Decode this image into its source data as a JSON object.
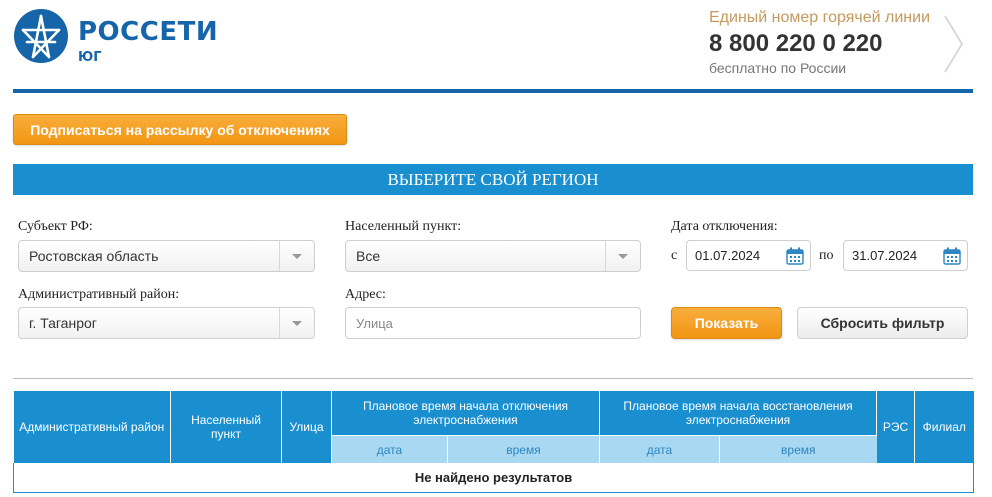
{
  "header": {
    "logo_title": "РОССЕТИ",
    "logo_subtitle": "ЮГ",
    "hotline_label": "Единый номер горячей линии",
    "hotline_number": "8 800 220 0 220",
    "hotline_note": "бесплатно по России"
  },
  "subscribe_label": "Подписаться на рассылку об отключениях",
  "region_title": "ВЫБЕРИТЕ СВОЙ РЕГИОН",
  "filters": {
    "subject_label": "Субъект РФ:",
    "subject_value": "Ростовская область",
    "locality_label": "Населенный пункт:",
    "locality_value": "Все",
    "date_label": "Дата отключения:",
    "date_from_prefix": "с",
    "date_from": "01.07.2024",
    "date_to_prefix": "по",
    "date_to": "31.07.2024",
    "district_label": "Административный район:",
    "district_value": "г. Таганрог",
    "address_label": "Адрес:",
    "address_placeholder": "Улица",
    "show_label": "Показать",
    "reset_label": "Сбросить фильтр"
  },
  "table": {
    "columns": [
      "Административный район",
      "Населенный пункт",
      "Улица",
      "Плановое время начала отключения электроснабжения",
      "Плановое время начала восстановления электроснабжения",
      "РЭС",
      "Филиал"
    ],
    "subcolumns": [
      "дата",
      "время",
      "дата",
      "время"
    ],
    "empty_message": "Не найдено результатов"
  },
  "colors": {
    "brand_blue": "#1565a8",
    "header_blue": "#1a8fd0",
    "subheader_blue": "#a8d8f2",
    "accent_orange": "#f29513",
    "hotline_gold": "#c49a5c"
  },
  "icons": [
    "rosseti-logo",
    "chevron-right-icon",
    "dropdown-caret-icon",
    "calendar-icon"
  ]
}
